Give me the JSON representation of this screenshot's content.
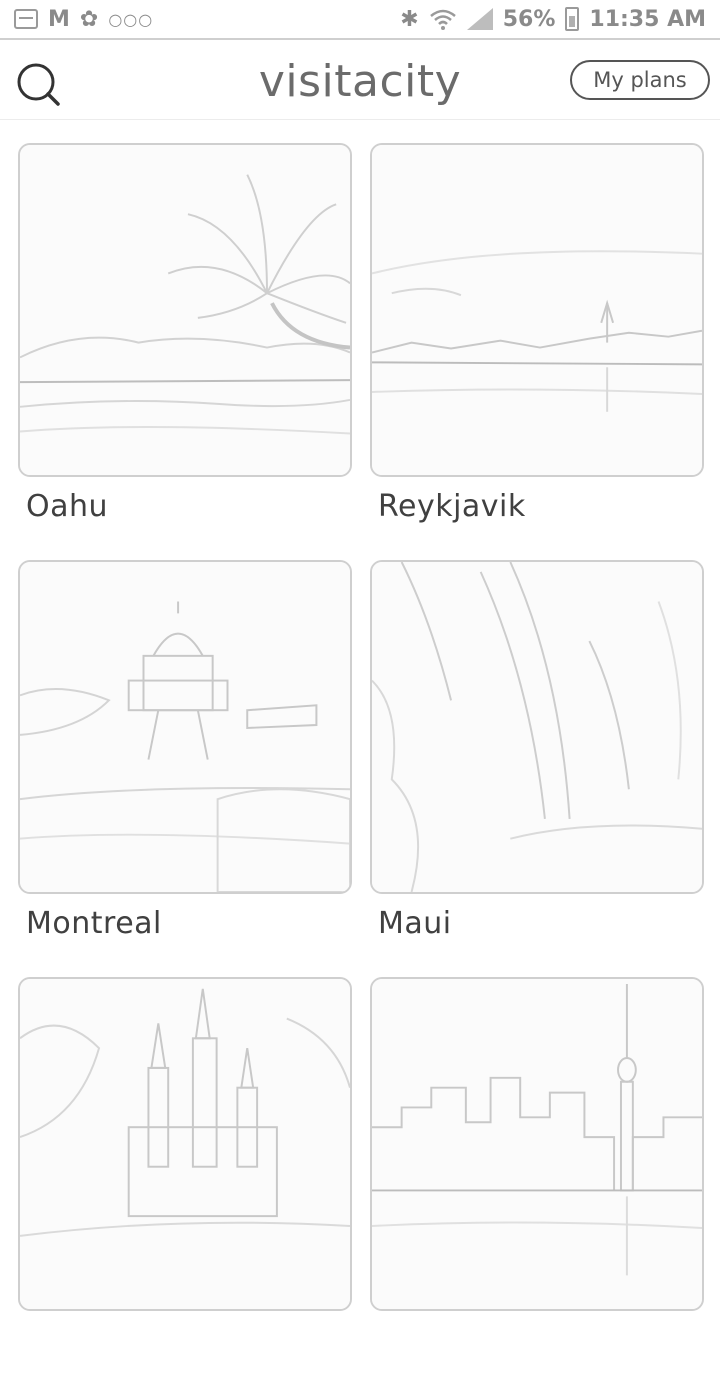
{
  "status_bar": {
    "battery": "56%",
    "time": "11:35 AM",
    "icons": [
      "gallery-icon",
      "mail-icon",
      "flower-icon",
      "dots-icon",
      "bluetooth-icon",
      "wifi-icon",
      "signal-icon",
      "battery-icon"
    ]
  },
  "header": {
    "logo": "visitacity",
    "my_plans_label": "My plans",
    "search_icon": "search-icon"
  },
  "cities": [
    {
      "name": "Oahu",
      "scene": "beach-palm"
    },
    {
      "name": "Reykjavik",
      "scene": "harbor-church"
    },
    {
      "name": "Montreal",
      "scene": "basilica"
    },
    {
      "name": "Maui",
      "scene": "waterfall"
    },
    {
      "name": "",
      "scene": "castle"
    },
    {
      "name": "",
      "scene": "skyline-tower"
    }
  ]
}
